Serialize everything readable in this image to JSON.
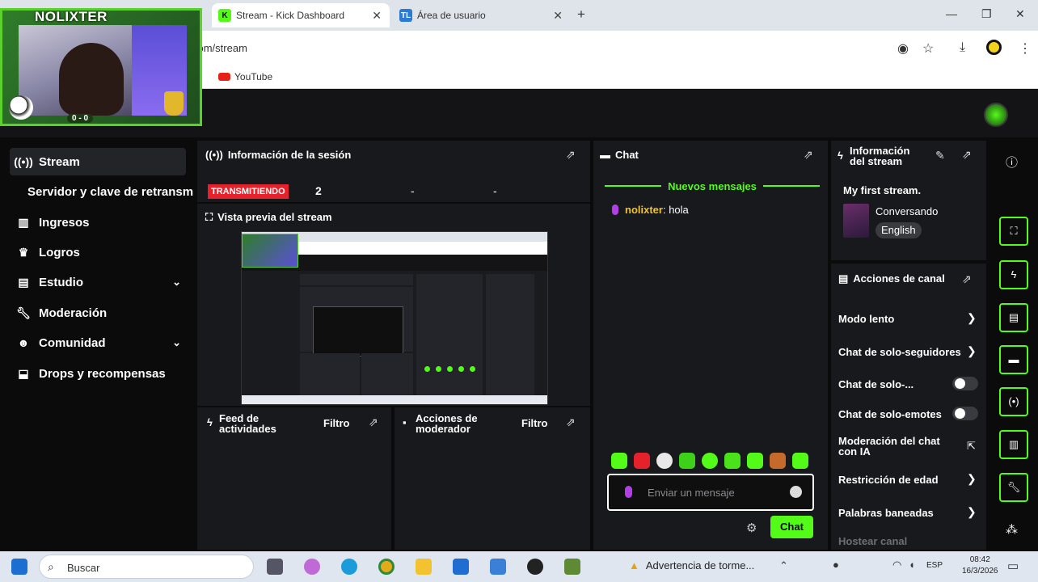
{
  "browser": {
    "tabs": [
      {
        "label": "Stream - Kick Dashboard",
        "icon": "kick-icon"
      },
      {
        "label": "Área de usuario",
        "icon": "tl-icon"
      }
    ],
    "url": "com/stream",
    "bookmark": "YouTube"
  },
  "overlay": {
    "title": "NOLIXTER",
    "score": "0 - 0"
  },
  "sidebar": {
    "items": [
      {
        "label": "Stream",
        "icon": "broadcast-icon",
        "active": true
      },
      {
        "label": "Servidor y clave de retransm",
        "icon": ""
      },
      {
        "label": "Ingresos",
        "icon": "chart-icon"
      },
      {
        "label": "Logros",
        "icon": "trophy-icon"
      },
      {
        "label": "Estudio",
        "icon": "studio-icon"
      },
      {
        "label": "Moderación",
        "icon": "wrench-icon"
      },
      {
        "label": "Comunidad",
        "icon": "community-icon"
      },
      {
        "label": "Drops y recompensas",
        "icon": "drops-icon"
      }
    ]
  },
  "session": {
    "title": "Información de la sesión",
    "status": "TRANSMITIENDO",
    "viewers": "2",
    "dash1": "-",
    "dash2": "-"
  },
  "preview": {
    "title": "Vista previa del stream"
  },
  "feed": {
    "title_line1": "Feed de",
    "title_line2": "actividades",
    "filter": "Filtro"
  },
  "mod_actions": {
    "title_line1": "Acciones de",
    "title_line2": "moderador",
    "filter": "Filtro"
  },
  "chat": {
    "title": "Chat",
    "new_messages": "Nuevos mensajes",
    "messages": [
      {
        "user": "nolixter",
        "text": "hola"
      }
    ],
    "placeholder": "Enviar un mensaje",
    "send_label": "Chat"
  },
  "stream_info": {
    "title_line1": "Información",
    "title_line2": "del stream",
    "stream_title": "My first stream.",
    "category": "Conversando",
    "language": "English"
  },
  "channel_actions": {
    "title": "Acciones de canal",
    "items": [
      {
        "label": "Modo lento",
        "control": "chevron"
      },
      {
        "label": "Chat de solo-seguidores",
        "control": "chevron"
      },
      {
        "label": "Chat de solo-...",
        "control": "toggle",
        "on": false
      },
      {
        "label": "Chat de solo-emotes",
        "control": "toggle",
        "on": false
      },
      {
        "label_line1": "Moderación del chat",
        "label_line2": "con IA",
        "control": "external"
      },
      {
        "label": "Restricción de edad",
        "control": "chevron"
      },
      {
        "label": "Palabras baneadas",
        "control": "chevron"
      },
      {
        "label": "Hostear canal",
        "control": "none"
      }
    ]
  },
  "taskbar": {
    "search_placeholder": "Buscar",
    "weather": "Advertencia de torme...",
    "language": "ESP",
    "time": "08:42",
    "date": "16/3/2026"
  },
  "colors": {
    "accent": "#53fc18",
    "live": "#e5222c",
    "panel": "#18191c",
    "background": "#0b0b0c"
  }
}
